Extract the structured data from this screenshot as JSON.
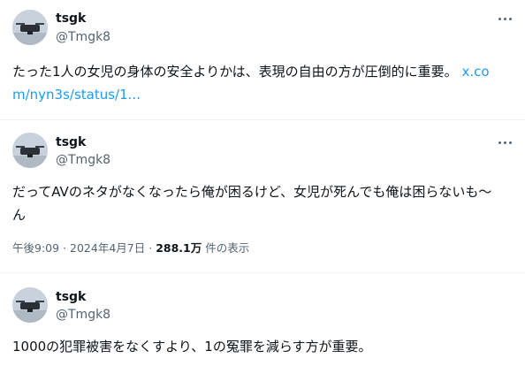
{
  "tweets": [
    {
      "author_name": "tsgk",
      "author_handle": "@Tmgk8",
      "text": "たった1人の女児の身体の安全よりかは、表現の自由の方が圧倒的に重要。",
      "link": "x.com/nyn3s/status/1..."
    },
    {
      "author_name": "tsgk",
      "author_handle": "@Tmgk8",
      "text": "だってAVのネタがなくなったら俺が困るけど、女児が死んでも俺は困らないも～ん",
      "time": "午後9:09",
      "separator": "·",
      "date": "2024年4月7日",
      "views_count": "288.1万",
      "views_label": "件の表示"
    },
    {
      "author_name": "tsgk",
      "author_handle": "@Tmgk8",
      "text": "1000の犯罪被害をなくすより、1の冤罪を減らす方が重要。"
    }
  ],
  "icons": {
    "avatar": "drone-avatar-icon",
    "more": "more-horizontal-icon"
  },
  "colors": {
    "link": "#1d9bf0",
    "secondary_text": "#536471",
    "primary_text": "#0f1419",
    "divider": "#eff3f4"
  }
}
